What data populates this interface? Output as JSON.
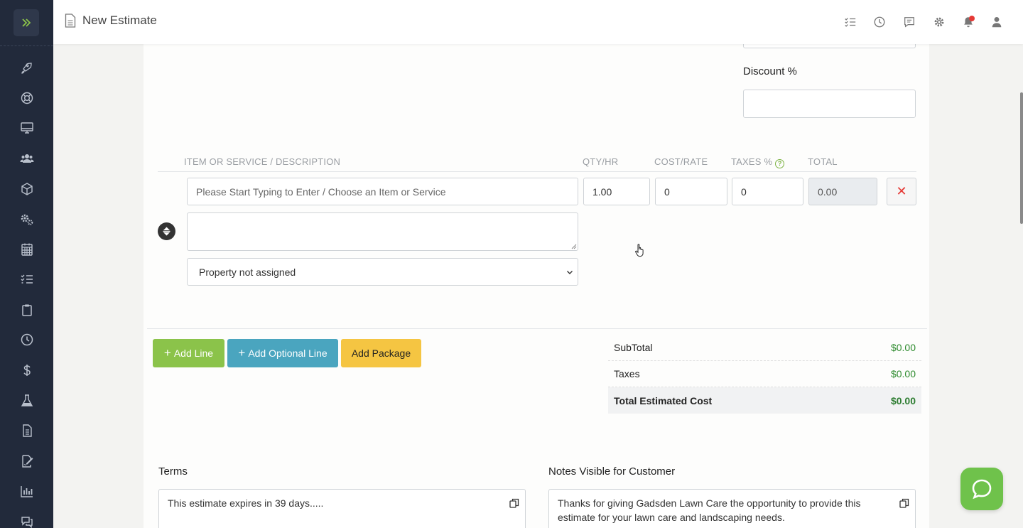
{
  "header": {
    "title": "New Estimate"
  },
  "pricing": {
    "discount_label": "Discount %",
    "discount_value": ""
  },
  "line_items": {
    "columns": {
      "item": "ITEM OR SERVICE / DESCRIPTION",
      "qty": "QTY/HR",
      "cost": "COST/RATE",
      "taxes": "TAXES %",
      "total": "TOTAL"
    },
    "rows": [
      {
        "item_placeholder": "Please Start Typing to Enter / Choose an Item or Service",
        "qty": "1.00",
        "cost": "0",
        "taxes": "0",
        "total": "0.00",
        "description": "",
        "property": "Property not assigned"
      }
    ],
    "delete_symbol": "✕"
  },
  "buttons": {
    "add_line": "Add Line",
    "add_optional_line": "Add Optional Line",
    "add_package": "Add Package",
    "plus": "+"
  },
  "summary": {
    "subtotal_label": "SubTotal",
    "subtotal_value": "$0.00",
    "taxes_label": "Taxes",
    "taxes_value": "$0.00",
    "total_label": "Total Estimated Cost",
    "total_value": "$0.00"
  },
  "terms": {
    "label": "Terms",
    "text": "This estimate expires in 39 days....."
  },
  "notes": {
    "label": "Notes Visible for Customer",
    "text": "Thanks for giving Gadsden Lawn Care the opportunity to provide this estimate for your lawn care and landscaping needs."
  },
  "colors": {
    "sidebar": "#222a3b",
    "accent_green": "#8bc34a",
    "accent_blue": "#4aa5bf",
    "accent_yellow": "#f5c542",
    "danger": "#e53935"
  },
  "icons": {
    "sidebar": [
      "rocket-icon",
      "lifebuoy-icon",
      "monitor-icon",
      "users-icon",
      "box-icon",
      "gears-icon",
      "calendar-icon",
      "checklist-icon",
      "clipboard-icon",
      "clock-icon",
      "dollar-icon",
      "flask-icon",
      "document-icon",
      "signature-icon",
      "chart-icon",
      "chat-icon"
    ],
    "topbar": [
      "checklist-icon",
      "clock-icon",
      "message-icon",
      "gear-icon",
      "bell-icon",
      "user-icon"
    ]
  }
}
